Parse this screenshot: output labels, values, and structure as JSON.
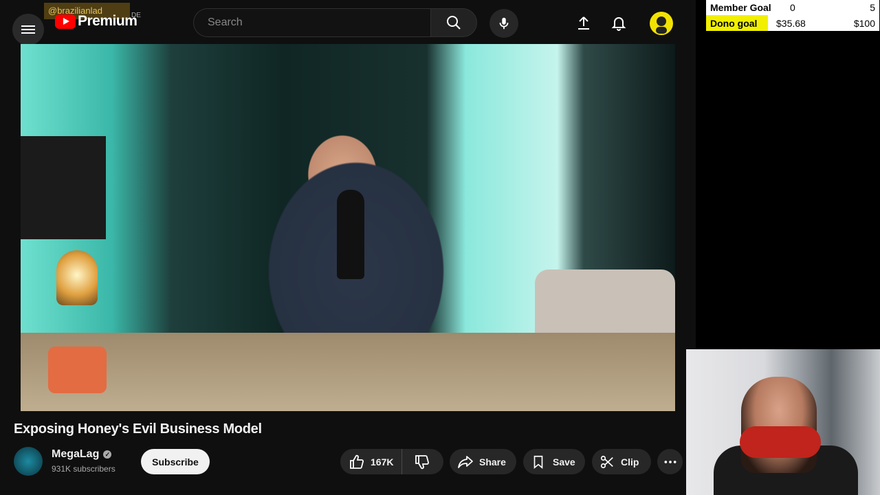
{
  "overlay": {
    "username": "@brazilianlad"
  },
  "masthead": {
    "logo_text": "Premium",
    "country_code": "DE",
    "search_placeholder": "Search"
  },
  "video": {
    "title": "Exposing Honey's Evil Business Model",
    "channel": {
      "name": "MegaLag",
      "subscribers": "931K subscribers",
      "verified": true
    },
    "subscribe_label": "Subscribe",
    "likes": "167K",
    "share_label": "Share",
    "save_label": "Save",
    "clip_label": "Clip"
  },
  "goals": {
    "member": {
      "label": "Member Goal",
      "current": "0",
      "target": "5"
    },
    "dono": {
      "label": "Dono goal",
      "current": "$35.68",
      "target": "$100",
      "progress": 0.3568,
      "fill_color": "#f2f000"
    }
  },
  "icons": [
    "menu-icon",
    "youtube-logo-icon",
    "search-icon",
    "microphone-icon",
    "upload-icon",
    "bell-icon",
    "thumbs-up-icon",
    "thumbs-down-icon",
    "share-icon",
    "bookmark-icon",
    "scissors-icon",
    "more-icon"
  ]
}
